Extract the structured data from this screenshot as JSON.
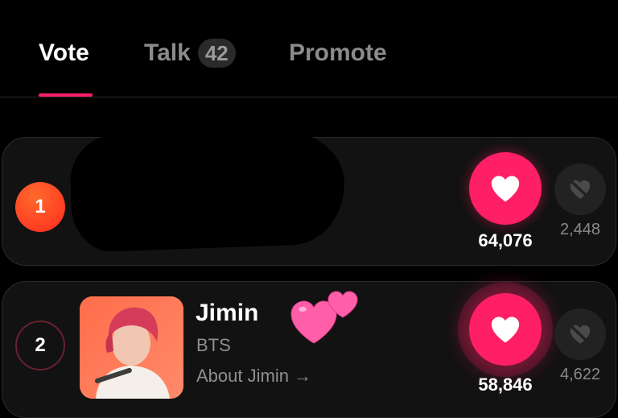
{
  "tabs": {
    "vote": "Vote",
    "talk": "Talk",
    "talk_count": "42",
    "promote": "Promote"
  },
  "accent_color": "#ff1f67",
  "ranking": [
    {
      "rank": "1",
      "name_redacted": true,
      "votes": "64,076",
      "unvotes": "2,448"
    },
    {
      "rank": "2",
      "name": "Jimin",
      "group": "BTS",
      "about": "About Jimin →",
      "decoration": "two-hearts-emoji",
      "votes": "58,846",
      "unvotes": "4,622"
    }
  ]
}
